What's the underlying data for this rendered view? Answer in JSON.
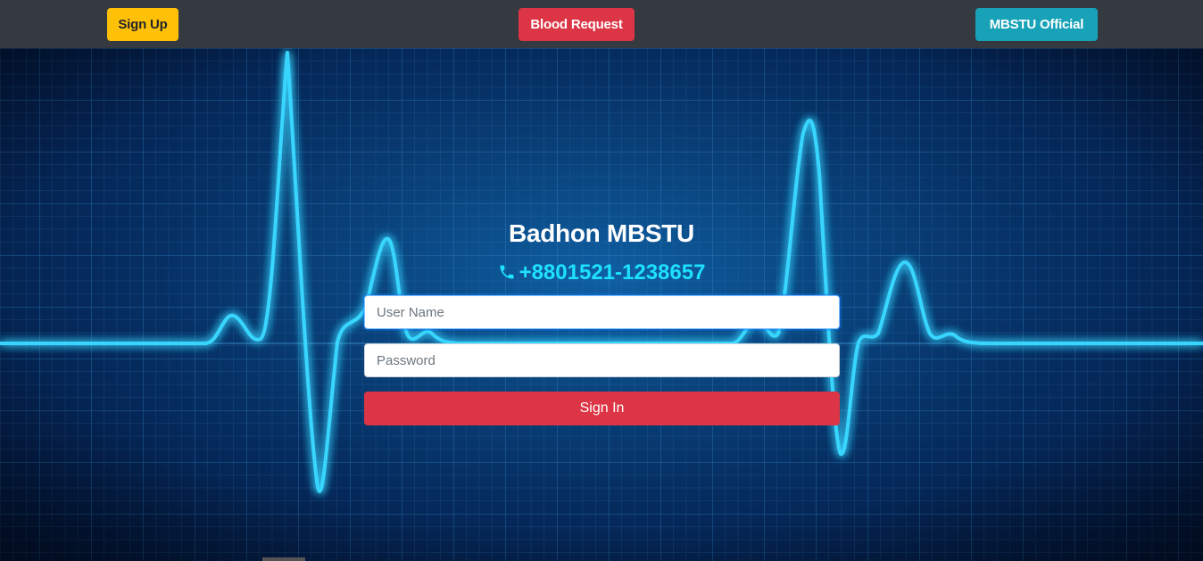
{
  "nav": {
    "signup_label": "Sign Up",
    "blood_request_label": "Blood Request",
    "official_label": "MBSTU Official"
  },
  "hero": {
    "title": "Badhon MBSTU",
    "phone": "+8801521-1238657",
    "phone_icon": "phone-icon"
  },
  "login": {
    "username_placeholder": "User Name",
    "password_placeholder": "Password",
    "submit_label": "Sign In"
  },
  "colors": {
    "navbar": "#343a40",
    "warning": "#ffc107",
    "danger": "#dc3545",
    "info": "#17a2b8",
    "phone_text": "#1ee0ff",
    "ecg_line": "#37d6ff"
  }
}
